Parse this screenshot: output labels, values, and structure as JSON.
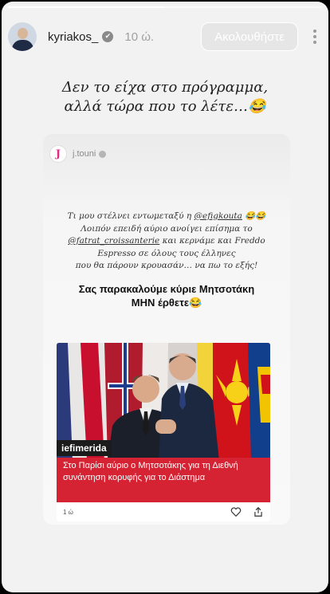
{
  "story": {
    "progress": 0.5
  },
  "header": {
    "username": "kyriakos_",
    "verified_glyph": "✔",
    "time": "10 ώ.",
    "follow_label": "Ακολουθήστε"
  },
  "caption": {
    "line1": "Δεν το είχα στο πρόγραμμα,",
    "line2": "αλλά τώρα που το λέτε…😂"
  },
  "shared_post": {
    "avatar_letter": "J",
    "username": "j.touni",
    "quote": {
      "p1": "Τι μου στέλνει εντωμεταξύ η ",
      "mention1": "@efigkouta",
      "p2": " 😂😂",
      "line2": "Λοιπόν επειδή αύριο ανοίγει επίσημα το",
      "mention2": "@fatrat_croissanterie",
      "p3": " και κερνάμε και Freddo",
      "line4": "Espresso σε όλους τους έλληνες",
      "line5": "που θα πάρουν κρουασάν… να πω το εξής!"
    },
    "plea_line1": "Σας παρακαλούμε κύριε Μητσοτάκη",
    "plea_line2": "ΜΗΝ έρθετε😂"
  },
  "news_card": {
    "brand": "iefimerida",
    "title": "Στο Παρίσι αύριο ο Μητσοτάκης για τη Διεθνή συνάντηση κορυφής για το Διάστημα",
    "age": "1 ώ",
    "colors": {
      "title_bg": "#d62333"
    }
  }
}
